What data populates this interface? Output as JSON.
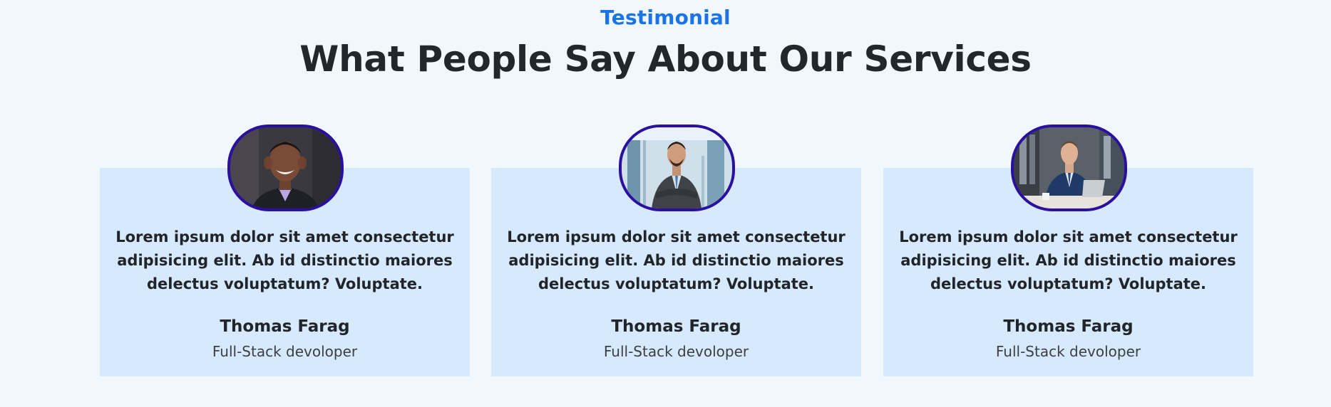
{
  "section": {
    "label": "Testimonial",
    "title": "What People Say About Our Services"
  },
  "testimonials": [
    {
      "quote": "Lorem ipsum dolor sit amet consectetur adipisicing elit. Ab id distinctio maiores delectus voluptatum? Voluptate.",
      "name": "Thomas Farag",
      "role": "Full-Stack devoloper",
      "avatar_icon": "person-photo"
    },
    {
      "quote": "Lorem ipsum dolor sit amet consectetur adipisicing elit. Ab id distinctio maiores delectus voluptatum? Voluptate.",
      "name": "Thomas Farag",
      "role": "Full-Stack devoloper",
      "avatar_icon": "person-photo"
    },
    {
      "quote": "Lorem ipsum dolor sit amet consectetur adipisicing elit. Ab id distinctio maiores delectus voluptatum? Voluptate.",
      "name": "Thomas Farag",
      "role": "Full-Stack devoloper",
      "avatar_icon": "person-photo"
    }
  ],
  "colors": {
    "background": "#f0f8fe",
    "accent": "#1a73e8",
    "card": "#d7e9fd",
    "avatar_border": "#2a0fa0"
  }
}
